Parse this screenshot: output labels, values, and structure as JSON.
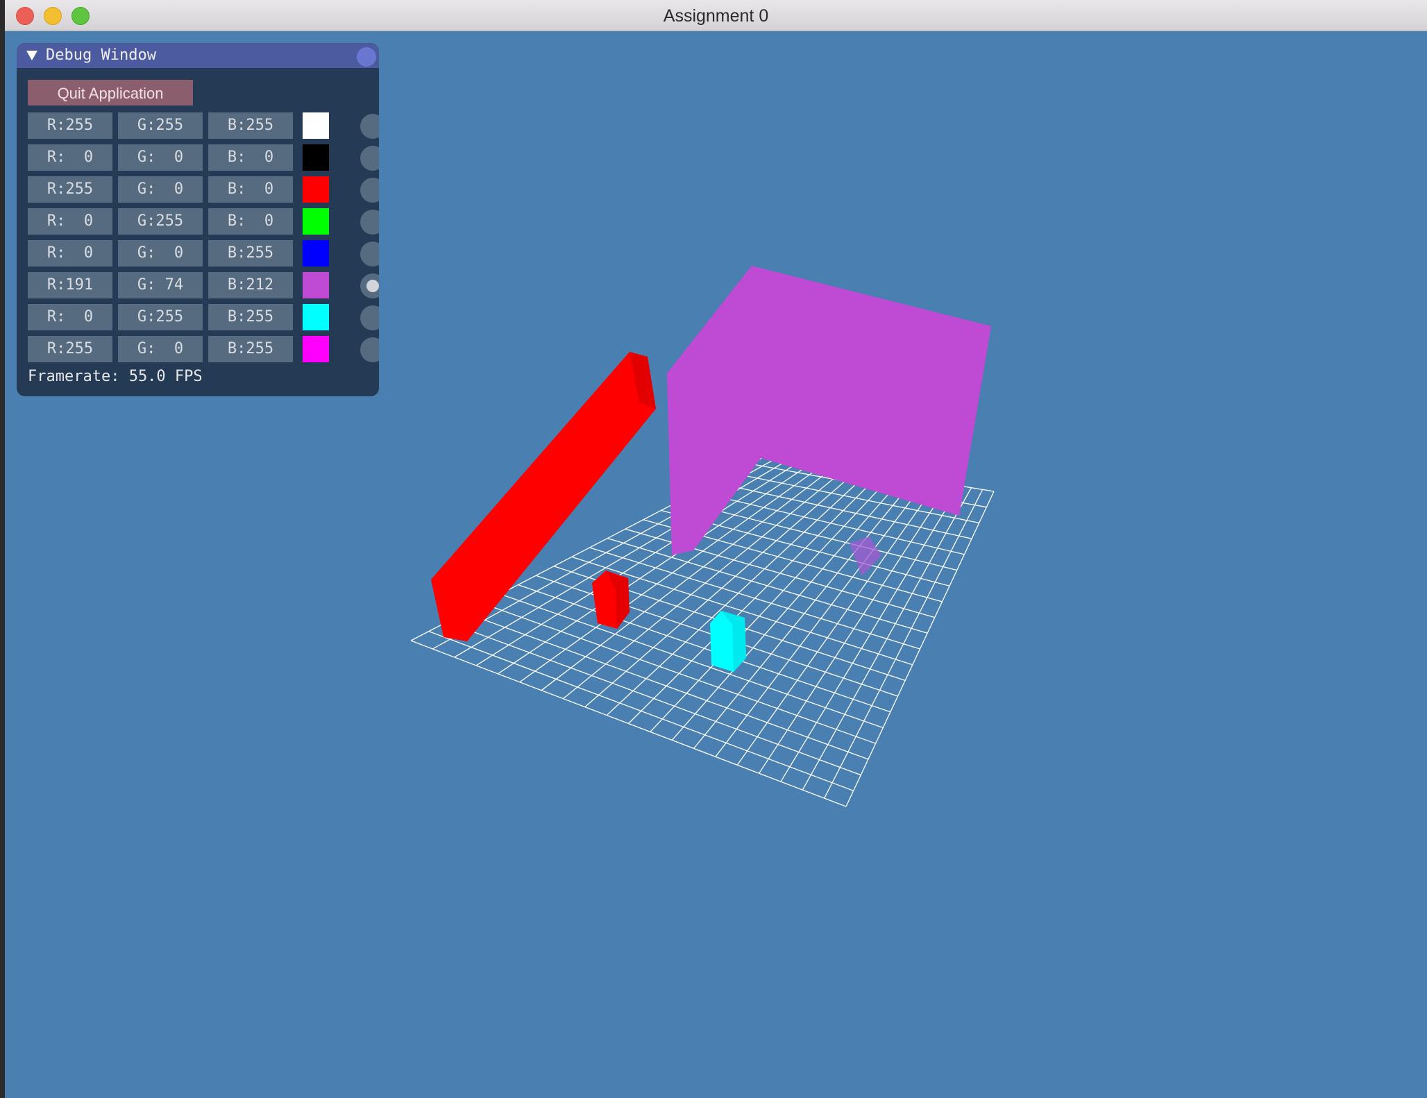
{
  "window": {
    "title": "Assignment 0"
  },
  "colors": {
    "background": "#4a7fb1",
    "wall": "#ff0000",
    "box": "#bf4ad4",
    "small_red": "#ff0000",
    "cyan": "#00ffff",
    "grid": "#ffffff"
  },
  "debug": {
    "title": "Debug Window",
    "quit_label": "Quit Application",
    "framerate": "Framerate: 55.0 FPS",
    "rows": [
      {
        "r": "R:255",
        "g": "G:255",
        "b": "B:255",
        "color": "#ffffff",
        "selected": false
      },
      {
        "r": "R:  0",
        "g": "G:  0",
        "b": "B:  0",
        "color": "#000000",
        "selected": false
      },
      {
        "r": "R:255",
        "g": "G:  0",
        "b": "B:  0",
        "color": "#ff0000",
        "selected": false
      },
      {
        "r": "R:  0",
        "g": "G:255",
        "b": "B:  0",
        "color": "#00ff00",
        "selected": false
      },
      {
        "r": "R:  0",
        "g": "G:  0",
        "b": "B:255",
        "color": "#0000ff",
        "selected": false
      },
      {
        "r": "R:191",
        "g": "G: 74",
        "b": "B:212",
        "color": "#bf4ad4",
        "selected": true
      },
      {
        "r": "R:  0",
        "g": "G:255",
        "b": "B:255",
        "color": "#00ffff",
        "selected": false
      },
      {
        "r": "R:255",
        "g": "G:  0",
        "b": "B:255",
        "color": "#ff00ff",
        "selected": false
      }
    ]
  }
}
